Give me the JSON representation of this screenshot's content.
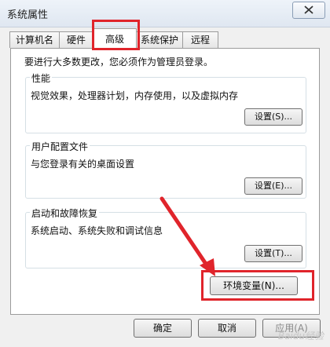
{
  "window": {
    "title": "系统属性",
    "close_icon": "close-icon"
  },
  "tabs": [
    {
      "label": "计算机名",
      "active": false
    },
    {
      "label": "硬件",
      "active": false
    },
    {
      "label": "高级",
      "active": true
    },
    {
      "label": "系统保护",
      "active": false
    },
    {
      "label": "远程",
      "active": false
    }
  ],
  "intro": "要进行大多数更改，您必须作为管理员登录。",
  "groups": {
    "performance": {
      "title": "性能",
      "description": "视觉效果，处理器计划，内存使用，以及虚拟内存",
      "button": "设置(S)..."
    },
    "user_profiles": {
      "title": "用户配置文件",
      "description": "与您登录有关的桌面设置",
      "button": "设置(E)..."
    },
    "startup_recovery": {
      "title": "启动和故障恢复",
      "description": "系统启动、系统失败和调试信息",
      "button": "设置(T)..."
    }
  },
  "env_button": "环境变量(N)...",
  "footer": {
    "ok": "确定",
    "cancel": "取消",
    "apply": "应用(A)"
  },
  "annotation_color": "#e0242b",
  "watermark": "Baidu经验"
}
